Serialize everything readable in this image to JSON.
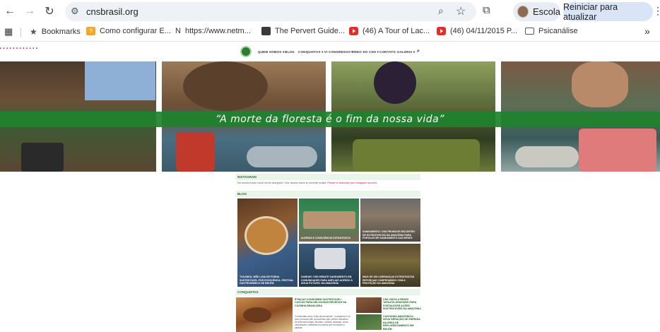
{
  "browser": {
    "url": "cnsbrasil.org",
    "profile_name": "Escola",
    "update_button": "Reiniciar para atualizar",
    "bookmarks": [
      {
        "label": "Bookmarks",
        "icon": "star-icon"
      },
      {
        "label": "Como configurar E...",
        "icon": "question-icon"
      },
      {
        "label": "https://www.netm...",
        "icon": "n-icon"
      },
      {
        "label": "The Pervert Guide...",
        "icon": "film-icon"
      },
      {
        "label": "(46) A Tour of Lac...",
        "icon": "youtube-icon"
      },
      {
        "label": "(46) 04/11/2015 P...",
        "icon": "youtube-icon"
      },
      {
        "label": "Psicanálise",
        "icon": "folder-icon"
      }
    ],
    "overflow_label": "»"
  },
  "site": {
    "nav": [
      "QUEM SOMOS ▾",
      "BLOG",
      "CONQUISTAS ▾",
      "VI CONGRESSO ▾",
      "VÍDEO DO CNS ▾",
      "CONTATO",
      "GALERIA ▾"
    ],
    "hero_quote": "“A morte da floresta é o fim da nossa vida”",
    "instagram": {
      "title": "INSTAGRAM",
      "note": "The access token could not be decrypted. Your access token is currently invalid.",
      "link": "Please re-authorize your Instagram account."
    },
    "blog": {
      "title": "BLOG",
      "posts": [
        "TUCANDA: MÃE LAVA DE FORNA SUSTENTÁVEL POR EXCELÊNCIA: FESTIVAL GASTRONÔMICO DE BELÉM",
        "ALERGIA E CONSCIÊNCIA EXTRATIVISTA",
        "SANEAMENTO: CNS PROMOVE ENCONTRO DE EXTRATIVISTAS NA AMAZÔNIA PARA FORTALECER SANEAMENTO DAS RESEX",
        "SANEAR: CNS DEBATE SANEAMENTO EM COMUNIDADES PARA AMPLIAR ACESSO À ÁGUA POTÁVEL NA AMAZÔNIA",
        "MAIS DE 400 LIDERANÇAS EXTRATIVISTAS REFORÇAM COMPROMISSO COM A PROTEÇÃO DA AMAZÔNIA"
      ]
    },
    "conquistas": {
      "title": "CONQUISTAS",
      "main_title": "ÉTNICAS CONSOMEM SUSTENTÁVEL: CASTAS PARA DELICIOSAS RECEITAS NA COZINHA BRASILEIRA",
      "main_body": "Conhecidas como “joias da Amazônia”, a castanha e os seus produtos são consumidos pelo público brasileiro de diversas formas: fervidas, cozidas, assadas, cruas, misturadas e utilizadas em pratos que encantam o paladar.",
      "side": [
        "CNS VISITA A RESEX TAPAJÓS-ARAPIUNS PARA FORTALECER AÇÕES SUSTENTÁVEIS NA AMAZÔNIA",
        "CASTANHA AMAZÔNICA: NOVA GERAÇÃO DE ENERGIA NA ÁREA DE REFLORESTAMENTO EM BELÉM"
      ]
    }
  }
}
